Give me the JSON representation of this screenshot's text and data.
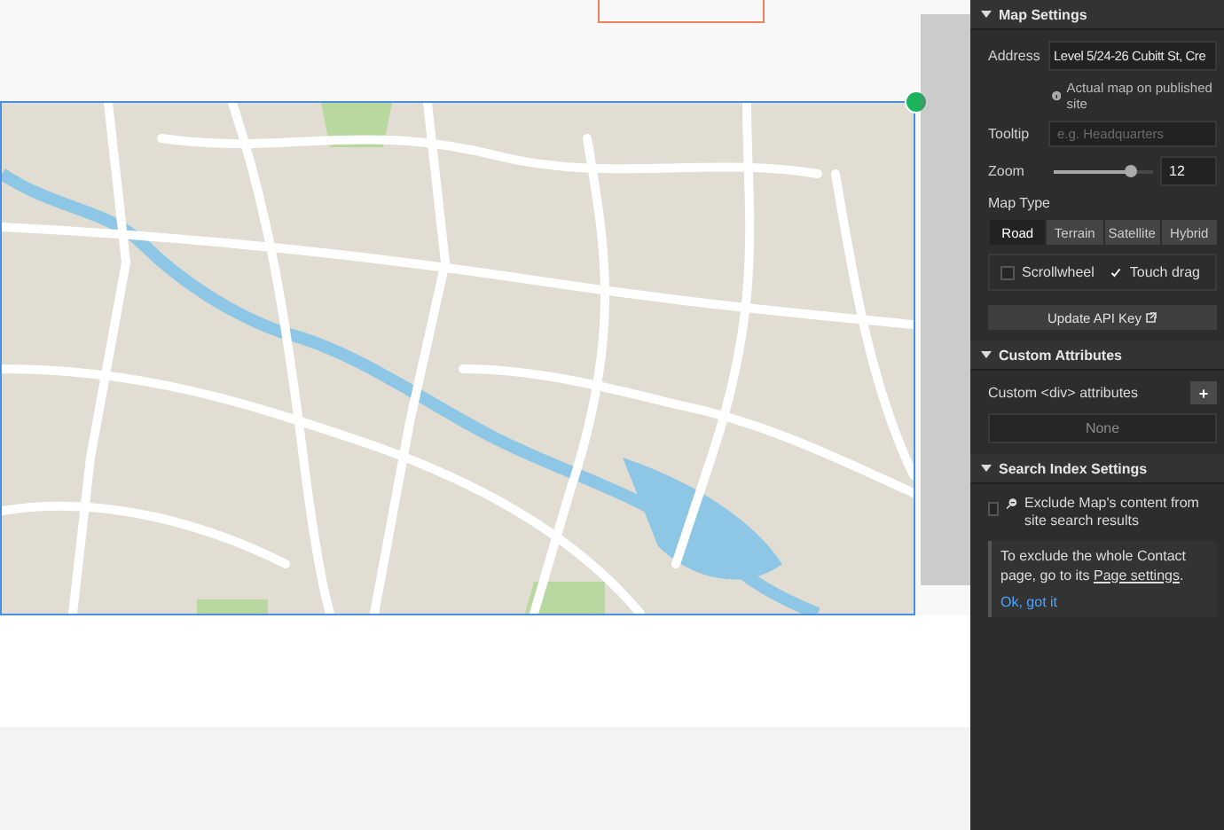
{
  "map_settings": {
    "title": "Map Settings",
    "expanded": true,
    "address": {
      "label": "Address",
      "value": "Level 5/24-26 Cubitt St, Cre"
    },
    "note": "Actual map on published site",
    "tooltip": {
      "label": "Tooltip",
      "placeholder": "e.g. Headquarters"
    },
    "zoom": {
      "label": "Zoom",
      "level": 0.78,
      "value": "12"
    },
    "map_type": {
      "label": "Map Type",
      "options": [
        {
          "label": "Road",
          "selected": true
        },
        {
          "label": "Terrain",
          "selected": false
        },
        {
          "label": "Satellite",
          "selected": false
        },
        {
          "label": "Hybrid",
          "selected": false
        }
      ]
    },
    "options": [
      {
        "label": "Scrollwheel",
        "checked": false
      },
      {
        "label": "Touch drag",
        "checked": true
      }
    ],
    "api_button": "Update API Key"
  },
  "custom_attributes": {
    "title": "Custom Attributes",
    "expanded": true,
    "row_label": "Custom <div> attributes",
    "add": "+",
    "empty": "None"
  },
  "search_index": {
    "title": "Search Index Settings",
    "expanded": true,
    "exclude": {
      "label": "Exclude Map's content from site search results",
      "checked": false
    },
    "hint_before": "To exclude the whole Contact page, go to its ",
    "hint_link": "Page settings",
    "hint_after": ".",
    "dismiss": "Ok, got it"
  }
}
